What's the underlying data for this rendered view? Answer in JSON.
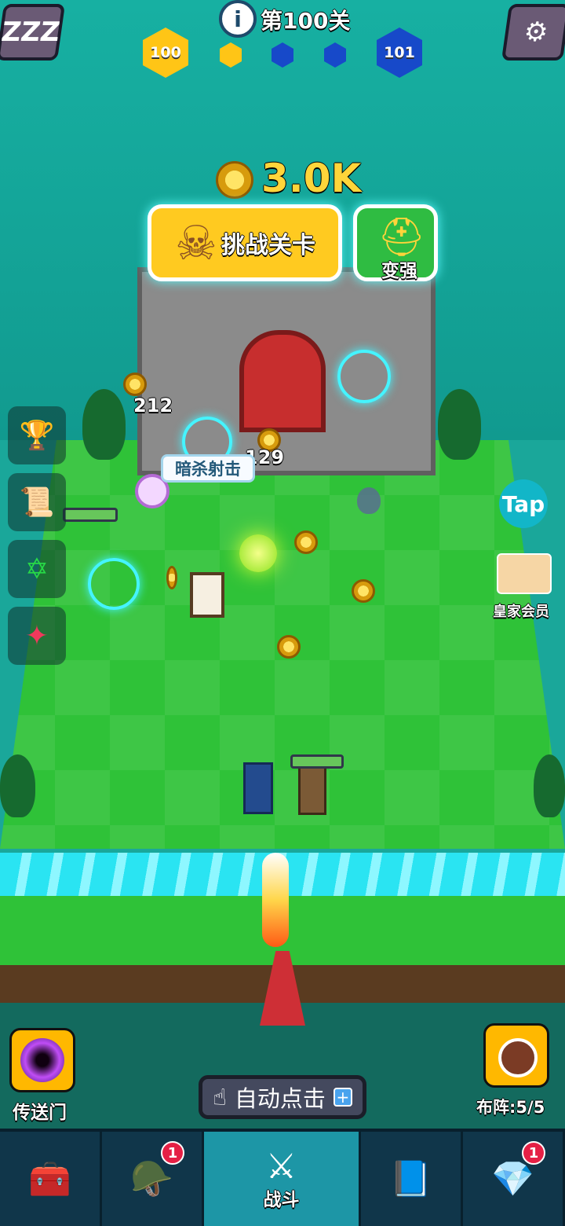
{
  "hud": {
    "sleep_label": "ZZZ",
    "info_icon": "i",
    "level_title": "第100关",
    "current_level": "100",
    "next_level": "101",
    "progress_hexes": [
      "yellow",
      "blue",
      "blue"
    ],
    "settings_icon": "gear-icon"
  },
  "challenge": {
    "reward": "3.0K",
    "challenge_label": "挑战关卡",
    "upgrade_label": "变强"
  },
  "battle": {
    "damage_1": "212",
    "damage_2": "129",
    "skill_label": "暗杀射击",
    "tap_label": "Tap",
    "royal_label": "皇家会员"
  },
  "bottom": {
    "portal_label": "传送门",
    "auto_click_label": "自动点击",
    "formation_label": "布阵:",
    "formation_value": "5/5",
    "nav": [
      {
        "label": "",
        "badge": ""
      },
      {
        "label": "",
        "badge": "1"
      },
      {
        "label": "战斗",
        "badge": ""
      },
      {
        "label": "",
        "badge": ""
      },
      {
        "label": "",
        "badge": "1"
      }
    ]
  },
  "colors": {
    "accent_gold": "#ffd23f",
    "accent_blue": "#1749c9",
    "cyan_ring": "#45f4ff"
  }
}
